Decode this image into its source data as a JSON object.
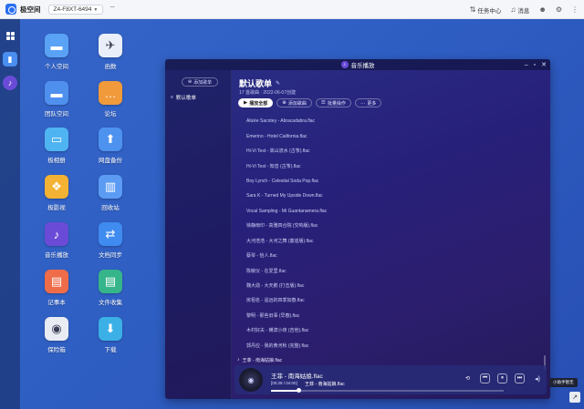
{
  "topbar": {
    "brand": "极空间",
    "device": "Z4-F8XT-6494",
    "task_center": "任务中心",
    "messages": "消息"
  },
  "desktop_icons": [
    {
      "id": "personal-space",
      "label": "个人空间",
      "color": "#5aa2f5",
      "icon": "folder-icon",
      "glyph": "▬"
    },
    {
      "id": "albums",
      "label": "函数",
      "color": "#e9eef9",
      "icon": "bird-icon",
      "glyph": "✈"
    },
    {
      "id": "team-space",
      "label": "团队空间",
      "color": "#4f90ef",
      "icon": "team-folder-icon",
      "glyph": "▬"
    },
    {
      "id": "forum",
      "label": "论坛",
      "color": "#f19a3c",
      "icon": "chat-icon",
      "glyph": "…"
    },
    {
      "id": "photos",
      "label": "极相册",
      "color": "#4fb4f2",
      "icon": "photo-icon",
      "glyph": "▭"
    },
    {
      "id": "backup",
      "label": "网盘备份",
      "color": "#4e92f0",
      "icon": "cloud-upload-icon",
      "glyph": "⬆"
    },
    {
      "id": "video",
      "label": "极影视",
      "color": "#f4b234",
      "icon": "film-icon",
      "glyph": "❖"
    },
    {
      "id": "recycle",
      "label": "回收站",
      "color": "#5b9bf3",
      "icon": "trash-icon",
      "glyph": "▥"
    },
    {
      "id": "music",
      "label": "音乐播放",
      "color": "#6a4bd8",
      "icon": "music-icon",
      "glyph": "♪"
    },
    {
      "id": "file-sync",
      "label": "文档同步",
      "color": "#3f8bf0",
      "icon": "sync-icon",
      "glyph": "⇄"
    },
    {
      "id": "notes",
      "label": "记事本",
      "color": "#ef6c49",
      "icon": "notebook-icon",
      "glyph": "▤"
    },
    {
      "id": "file-collect",
      "label": "文件收集",
      "color": "#36b58a",
      "icon": "file-collect-icon",
      "glyph": "▤"
    },
    {
      "id": "safe-box",
      "label": "保险箱",
      "color": "#e9ecf2",
      "icon": "safe-icon",
      "glyph": "◉"
    },
    {
      "id": "download",
      "label": "下载",
      "color": "#3bb0e6",
      "icon": "download-icon",
      "glyph": "⬇"
    }
  ],
  "player": {
    "window_title": "音乐播放",
    "create_playlist": "添加歌单",
    "sidebar_playlist": "默认歌单",
    "playlist_title": "默认歌单",
    "meta": "17 首歌曲 · 2022-06-07创建",
    "buttons": {
      "play_all": "播放全部",
      "add_music": "添加歌曲",
      "bulk": "批量操作",
      "more": "更多"
    },
    "tracks": [
      "Alizée Sacotey - Abracadabra.flac",
      "Emerino - Hotel California.flac",
      "Hi-Vi Test - 高山流水 (古筝).flac",
      "Hi-Vi Test - 知音 (古筝).flac",
      "Boy Lynch - Celestial Soda Pop.flac",
      "Sara K - Turned My Upside Down.flac",
      "Vocal Sampling - Mi Guantanamera.flac",
      "徐静雨印 - 高雅四合院 (交响版).flac",
      "大河浩浩 - 大河之舞 (童谣版).flac",
      "蔡琴 - 恰人.flac",
      "陈敏仪 - 在爱里.flac",
      "魏大勋 - 大天鹅 (打击版).flac",
      "房祖名 - 遥远的四季如春.flac",
      "黎明 - 那些旧事 (早春).flac",
      "木村好夫 - 横滨小夜 (吉他).flac",
      "郭丹应 - 我的黄河秋 (完整).flac",
      "王菲 - 南海姑娘.flac"
    ],
    "now_playing": {
      "title": "王菲 - 南海姑娘.flac",
      "time": "[00:28 / 04:00]",
      "subtitle": "王菲 - 南海姑娘.flac",
      "progress": 0.12
    }
  },
  "tip": "小助手暂无",
  "colors": {
    "accent": "#6a4bd8",
    "topbar": "#f4f6fa",
    "desktop": "#2f63c7"
  }
}
